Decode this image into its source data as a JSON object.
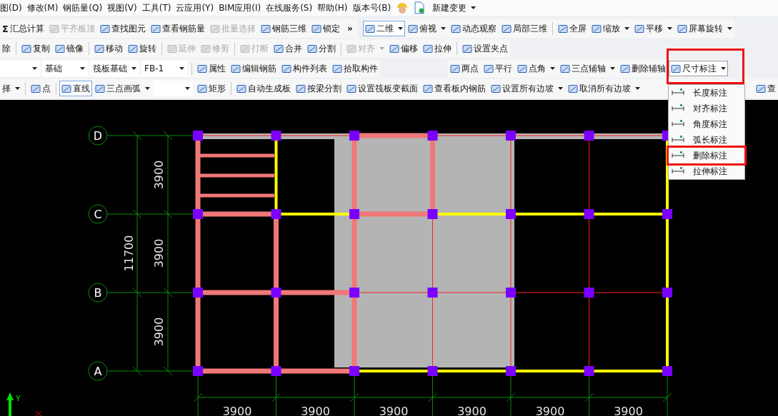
{
  "menu_bar": {
    "items": [
      "图(D)",
      "修改(M)",
      "钢筋量(Q)",
      "视图(V)",
      "工具(T)",
      "云应用(Y)",
      "BIM应用(I)",
      "在线服务(S)",
      "帮助(H)",
      "版本号(B)"
    ],
    "extra": {
      "label": "新建变更",
      "dropdown": true
    }
  },
  "toolbars": [
    {
      "groups": [
        [
          {
            "kind": "button",
            "label": "汇总计算",
            "icon": "Σ",
            "disabled": false,
            "selected": false
          },
          {
            "kind": "button",
            "label": "平齐板顶",
            "disabled": true,
            "selected": false
          },
          {
            "kind": "button",
            "label": "查找图元",
            "disabled": false,
            "selected": false
          },
          {
            "kind": "button",
            "label": "查看钢筋量",
            "disabled": false,
            "selected": false
          },
          {
            "kind": "button",
            "label": "批量选择",
            "disabled": true,
            "selected": false
          },
          {
            "kind": "button",
            "label": "钢筋三维",
            "disabled": false,
            "selected": false
          },
          {
            "kind": "button",
            "label": "锁定",
            "disabled": false,
            "selected": false
          },
          {
            "kind": "overflow",
            "label": "»"
          }
        ],
        [
          {
            "kind": "split",
            "label": "二维",
            "disabled": false,
            "selected": true
          },
          {
            "kind": "split",
            "label": "俯视",
            "disabled": false,
            "selected": false
          },
          {
            "kind": "button",
            "label": "动态观察",
            "disabled": false,
            "selected": false
          },
          {
            "kind": "button",
            "label": "局部三维",
            "disabled": false,
            "selected": false
          },
          {
            "kind": "separator"
          },
          {
            "kind": "button",
            "label": "全屏",
            "disabled": false,
            "selected": false
          },
          {
            "kind": "split",
            "label": "缩放",
            "disabled": false,
            "selected": false
          },
          {
            "kind": "split",
            "label": "平移",
            "disabled": false,
            "selected": false
          },
          {
            "kind": "split",
            "label": "屏幕旋转",
            "disabled": false,
            "selected": false
          }
        ]
      ]
    },
    {
      "groups": [
        [
          {
            "kind": "button",
            "label": "除",
            "disabled": false,
            "selected": false
          },
          {
            "kind": "separator"
          },
          {
            "kind": "button",
            "label": "复制",
            "disabled": false,
            "selected": false
          },
          {
            "kind": "button",
            "label": "镜像",
            "disabled": false,
            "selected": false
          },
          {
            "kind": "separator"
          },
          {
            "kind": "button",
            "label": "移动",
            "disabled": false,
            "selected": false
          },
          {
            "kind": "button",
            "label": "旋转",
            "disabled": false,
            "selected": false
          },
          {
            "kind": "separator"
          },
          {
            "kind": "button",
            "label": "延伸",
            "disabled": true,
            "selected": false
          },
          {
            "kind": "button",
            "label": "修剪",
            "disabled": true,
            "selected": false
          },
          {
            "kind": "separator"
          },
          {
            "kind": "button",
            "label": "打断",
            "disabled": true,
            "selected": false
          },
          {
            "kind": "button",
            "label": "合并",
            "disabled": false,
            "selected": false
          },
          {
            "kind": "button",
            "label": "分割",
            "disabled": false,
            "selected": false
          },
          {
            "kind": "separator"
          },
          {
            "kind": "split",
            "label": "对齐",
            "disabled": true,
            "selected": false
          },
          {
            "kind": "button",
            "label": "偏移",
            "disabled": false,
            "selected": false
          },
          {
            "kind": "button",
            "label": "拉伸",
            "disabled": false,
            "selected": false
          },
          {
            "kind": "separator"
          },
          {
            "kind": "button",
            "label": "设置夹点",
            "disabled": false,
            "selected": false
          }
        ]
      ]
    },
    {
      "groups": [
        [
          {
            "kind": "select"
          },
          {
            "kind": "select",
            "value": "基础"
          },
          {
            "kind": "select",
            "value": "筏板基础"
          },
          {
            "kind": "select",
            "value": "FB-1"
          },
          {
            "kind": "separator"
          },
          {
            "kind": "button",
            "label": "属性",
            "disabled": false,
            "selected": false
          },
          {
            "kind": "button",
            "label": "编辑钢筋",
            "disabled": false,
            "selected": false
          },
          {
            "kind": "button",
            "label": "构件列表",
            "disabled": false,
            "selected": false
          },
          {
            "kind": "button",
            "label": "拾取构件",
            "disabled": false,
            "selected": false
          }
        ],
        [
          {
            "kind": "button",
            "label": "两点",
            "disabled": false,
            "selected": false
          },
          {
            "kind": "button",
            "label": "平行",
            "disabled": false,
            "selected": false
          },
          {
            "kind": "split",
            "label": "点角",
            "disabled": false,
            "selected": false
          },
          {
            "kind": "split",
            "label": "三点辅轴",
            "disabled": false,
            "selected": false
          },
          {
            "kind": "button",
            "label": "删除辅轴",
            "disabled": false,
            "selected": false
          },
          {
            "kind": "split",
            "label": "尺寸标注",
            "disabled": false,
            "selected": true
          }
        ]
      ]
    },
    {
      "groups": [
        [
          {
            "kind": "split",
            "label": "择",
            "disabled": false,
            "selected": false
          },
          {
            "kind": "separator"
          },
          {
            "kind": "button",
            "label": "点",
            "disabled": false,
            "selected": false
          },
          {
            "kind": "separator"
          },
          {
            "kind": "button",
            "label": "直线",
            "disabled": false,
            "selected": true
          },
          {
            "kind": "split",
            "label": "三点画弧",
            "disabled": false,
            "selected": false
          },
          {
            "kind": "select"
          },
          {
            "kind": "button",
            "label": "矩形",
            "disabled": false,
            "selected": false
          },
          {
            "kind": "separator"
          },
          {
            "kind": "button",
            "label": "自动生成板",
            "disabled": false,
            "selected": false
          },
          {
            "kind": "button",
            "label": "按梁分割",
            "disabled": false,
            "selected": false
          },
          {
            "kind": "button",
            "label": "设置筏板变截面",
            "disabled": false,
            "selected": false
          },
          {
            "kind": "button",
            "label": "查看板内钢筋",
            "disabled": false,
            "selected": false
          },
          {
            "kind": "split",
            "label": "设置所有边坡",
            "disabled": false,
            "selected": false
          },
          {
            "kind": "split",
            "label": "取消所有边坡",
            "disabled": false,
            "selected": false
          },
          {
            "kind": "spacer"
          },
          {
            "kind": "button",
            "label": "查",
            "disabled": false,
            "selected": false
          }
        ]
      ]
    }
  ],
  "dimension_menu": {
    "items": [
      {
        "label": "长度标注",
        "highlighted": false
      },
      {
        "label": "对齐标注",
        "highlighted": false
      },
      {
        "label": "角度标注",
        "highlighted": false
      },
      {
        "label": "弧长标注",
        "highlighted": false
      },
      {
        "label": "删除标注",
        "highlighted": true
      },
      {
        "label": "拉伸标注",
        "highlighted": false
      }
    ]
  },
  "canvas": {
    "row_axes": [
      "D",
      "C",
      "B",
      "A"
    ],
    "row_dims": [
      "3900",
      "3900",
      "3900"
    ],
    "total_dim": "11700",
    "column_dims": [
      "3900",
      "3900",
      "3900",
      "3900",
      "3900",
      "3900"
    ],
    "coord_label": "Y"
  }
}
